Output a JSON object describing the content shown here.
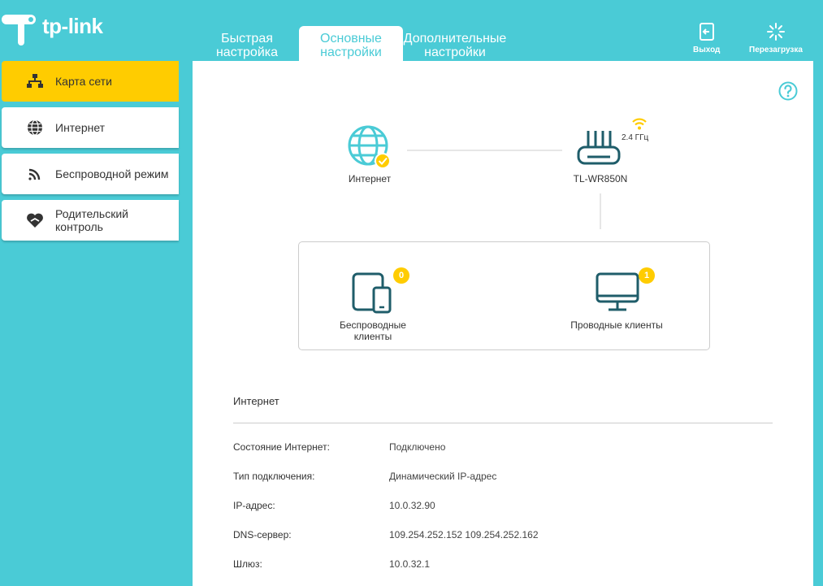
{
  "brand": {
    "logo_text": "tp-link"
  },
  "header": {
    "tabs": [
      {
        "label": "Быстрая настройка",
        "active": false
      },
      {
        "label": "Основные настройки",
        "active": true
      },
      {
        "label": "Дополнительные настройки",
        "active": false
      }
    ],
    "logout_label": "Выход",
    "reboot_label": "Перезагрузка"
  },
  "sidebar": {
    "items": [
      {
        "label": "Карта сети",
        "icon": "network-map-icon",
        "active": true
      },
      {
        "label": "Интернет",
        "icon": "globe-icon",
        "active": false
      },
      {
        "label": "Беспроводной режим",
        "icon": "wireless-icon",
        "active": false
      },
      {
        "label": "Родительский контроль",
        "icon": "parental-heart-icon",
        "active": false
      }
    ]
  },
  "map": {
    "internet_label": "Интернет",
    "router_label": "TL-WR850N",
    "band_label": "2.4 ГГц",
    "wireless_clients_label": "Беспроводные клиенты",
    "wireless_clients_count": "0",
    "wired_clients_label": "Проводные клиенты",
    "wired_clients_count": "1"
  },
  "internet_info": {
    "title": "Интернет",
    "rows": [
      {
        "key": "Состояние Интернет:",
        "value": "Подключено"
      },
      {
        "key": "Тип подключения:",
        "value": "Динамический IP-адрес"
      },
      {
        "key": "IP-адрес:",
        "value": "10.0.32.90"
      },
      {
        "key": "DNS-сервер:",
        "value": "109.254.252.152 109.254.252.162"
      },
      {
        "key": "Шлюз:",
        "value": "10.0.32.1"
      }
    ]
  },
  "colors": {
    "accent": "#4acbd6",
    "active": "#ffcc00",
    "icon_dark": "#1f5d6a"
  }
}
